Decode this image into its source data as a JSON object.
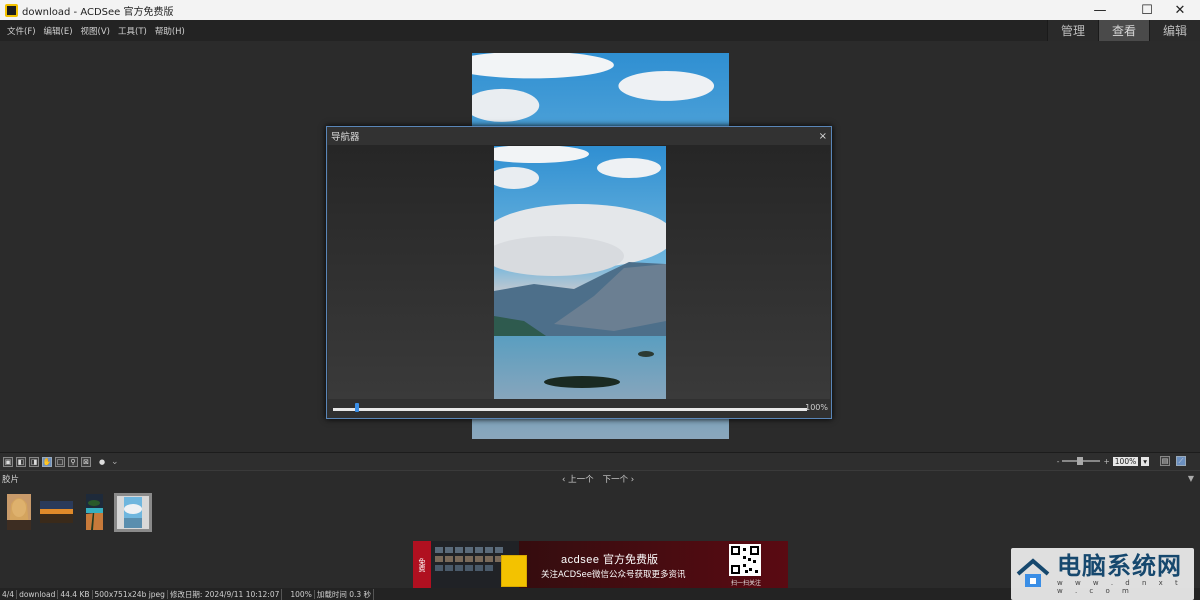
{
  "window": {
    "title": "download - ACDSee 官方免费版",
    "minimize": "—",
    "maximize": "☐",
    "close": "✕"
  },
  "menu": [
    "文件(F)",
    "编辑(E)",
    "视图(V)",
    "工具(T)",
    "帮助(H)"
  ],
  "modes": [
    "管理",
    "查看",
    "编辑"
  ],
  "active_mode": "查看",
  "navigator": {
    "title": "导航器",
    "close": "×",
    "zoom": "100%",
    "zoom_level": 0.05
  },
  "toolbar": {
    "zoom_minus": "-",
    "zoom_plus": "+",
    "zoom_value": "100%",
    "zoom_menu": "▾"
  },
  "filmstrip": {
    "label": "胶片",
    "prev": "‹ 上一个",
    "next": "下一个 ›",
    "collapse": "▼",
    "thumbnail_count": 4,
    "selected_index": 3
  },
  "ad": {
    "free_tag": "免费",
    "brand": "acdsee",
    "title": "官方免费版",
    "subtitle": "关注ACDSee微信公众号获取更多资讯",
    "qr_caption": "扫一扫关注"
  },
  "status": {
    "index": "4/4",
    "filename": "download",
    "size": "44.4 KB",
    "dimensions": "500x751x24b jpeg",
    "modified": "修改日期: 2024/9/11 10:12:07",
    "zoom": "100%",
    "load_time": "加载时间 0.3 秒"
  },
  "watermark": {
    "title": "电脑系统网",
    "url": "w w w . d n x t w . c o m"
  },
  "colors": {
    "accent": "#3a8ee6",
    "background": "#2b2b2b",
    "nav_border": "#5a86b8"
  }
}
